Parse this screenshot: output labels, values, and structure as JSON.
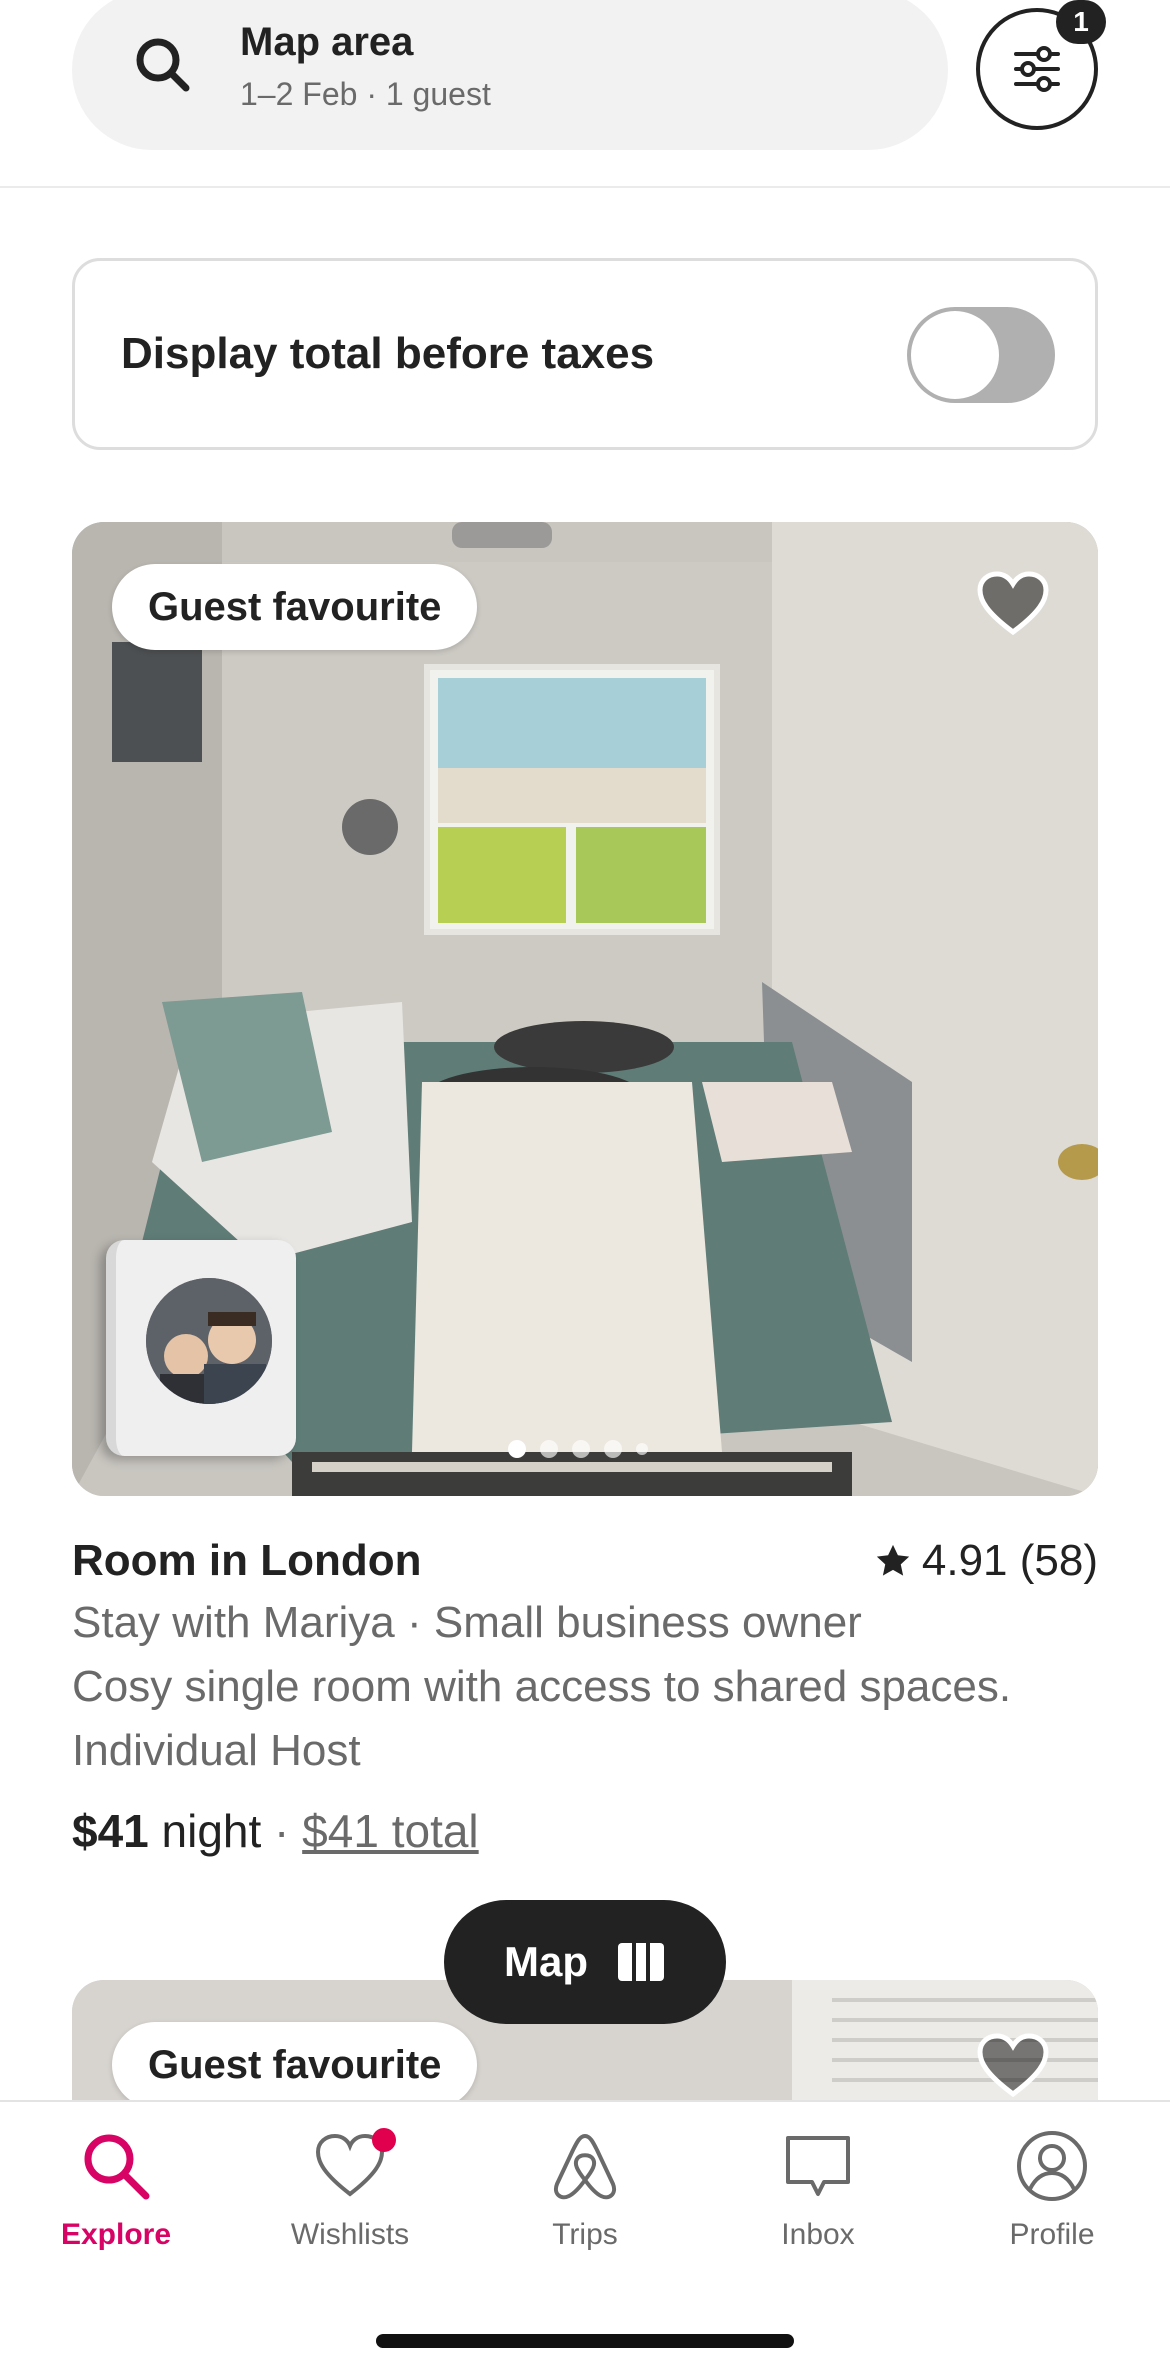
{
  "search": {
    "title": "Map area",
    "subtitle": "1–2 Feb · 1 guest",
    "filter_count": "1"
  },
  "tax_toggle": {
    "label": "Display total before taxes",
    "enabled": false
  },
  "listings": [
    {
      "badge": "Guest favourite",
      "title": "Room in London",
      "rating": "4.91 (58)",
      "host_line": "Stay with Mariya · Small business owner",
      "description": "Cosy single room with access to shared spaces.",
      "host_type": "Individual Host",
      "price": "$41",
      "price_unit": " night",
      "separator": " · ",
      "total": "$41 total",
      "photo_count": 5,
      "active_photo": 1
    },
    {
      "badge": "Guest favourite"
    }
  ],
  "map_button": {
    "label": "Map"
  },
  "tabbar": {
    "items": [
      {
        "label": "Explore",
        "icon": "search-icon",
        "active": true
      },
      {
        "label": "Wishlists",
        "icon": "heart-icon",
        "active": false
      },
      {
        "label": "Trips",
        "icon": "airbnb-logo-icon",
        "active": false
      },
      {
        "label": "Inbox",
        "icon": "chat-icon",
        "active": false
      },
      {
        "label": "Profile",
        "icon": "user-circle-icon",
        "active": false
      }
    ]
  },
  "colors": {
    "accent": "#d70466",
    "notification": "#e0004d",
    "text": "#222222",
    "muted": "#6a6a6a"
  }
}
